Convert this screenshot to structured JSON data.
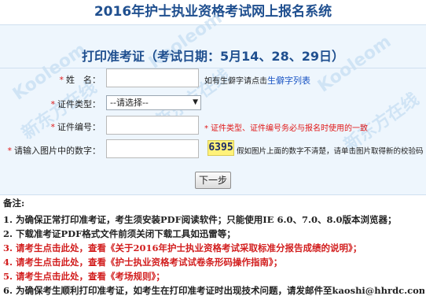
{
  "header": {
    "title": "2016年护士执业资格考试网上报名系统"
  },
  "section": {
    "title": "打印准考证（考试日期：5月14、28、29日）"
  },
  "watermark": {
    "text1": "Kooleom",
    "text2": "新东方在线"
  },
  "form": {
    "name": {
      "label": "姓　名：",
      "value": "",
      "hint_prefix": "如有生僻字请点击",
      "hint_link": "生僻字列表"
    },
    "id_type": {
      "label": "证件类型：",
      "selected": "--请选择--"
    },
    "id_number": {
      "label": "证件编号：",
      "value": "",
      "hint": "证件类型、证件编号务必与报名时使用的一致"
    },
    "captcha": {
      "label": "请输入图片中的数字：",
      "value": "",
      "code": "6395",
      "hint": "假如图片上面的数字不清楚，请单击图片取得新的校验码"
    },
    "submit_label": "下一步"
  },
  "notes": {
    "title": "备注:",
    "items": [
      {
        "text": "1. 为确保正常打印准考证，考生须安装PDF阅读软件；只能使用IE 6.0、7.0、8.0版本浏览器；",
        "color": "#222222"
      },
      {
        "text": "2. 下载准考证PDF格式文件前须关闭下载工具如迅雷等；",
        "color": "#222222"
      },
      {
        "text": "3. 请考生点击此处，查看《关于2016年护士执业资格考试采取标准分报告成绩的说明》；",
        "color": "#d21e1e"
      },
      {
        "text": "4. 请考生点击此处，查看《护士执业资格考试试卷条形码操作指南》；",
        "color": "#d21e1e"
      },
      {
        "text": "5. 请考生点击此处，查看《考场规则》；",
        "color": "#d21e1e"
      },
      {
        "text": "6. 为确保考生顺利打印准考证，如考生在打印准考证时出现技术问题，请发邮件至kaoshi@hhrdc.com。",
        "color": "#222222"
      }
    ]
  },
  "colors": {
    "accent": "#1f4f8f",
    "required": "#e01818",
    "panel": "#eef6fd",
    "captcha_bg": "#fff27a"
  }
}
